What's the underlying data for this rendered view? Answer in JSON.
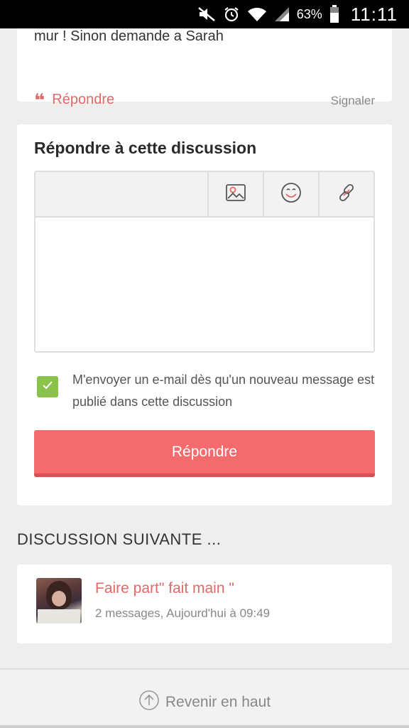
{
  "status_bar": {
    "battery": "63%",
    "time": "11:11"
  },
  "previous_message": {
    "text_fragment": "mur ! Sinon demande a Sarah",
    "reply_label": "Répondre",
    "report_label": "Signaler"
  },
  "reply_form": {
    "title": "Répondre à cette discussion",
    "toolbar_icons": [
      "image-icon",
      "smiley-icon",
      "link-icon"
    ],
    "textarea_value": "",
    "notify_checked": true,
    "notify_label": "M'envoyer un e-mail dès qu'un nouveau message est publié dans cette discussion",
    "submit_label": "Répondre"
  },
  "next_discussion": {
    "heading": "DISCUSSION SUIVANTE ...",
    "title": "Faire part\" fait main \"",
    "meta": "2 messages, Aujourd'hui à 09:49"
  },
  "footer": {
    "back_to_top": "Revenir en haut"
  },
  "colors": {
    "accent": "#f46b6e",
    "link": "#e06a6a",
    "check": "#8bc34a"
  }
}
